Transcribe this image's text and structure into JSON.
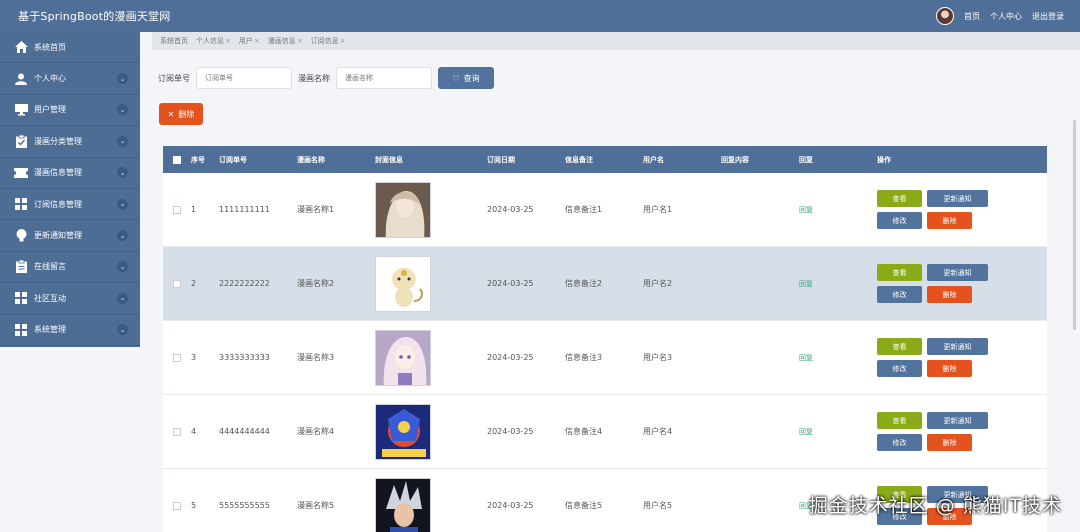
{
  "app": {
    "title": "基于SpringBoot的漫画天堂网"
  },
  "topnav": {
    "home": "首页",
    "profile": "个人中心",
    "logout": "退出登录"
  },
  "sidebar": {
    "items": [
      {
        "label": "系统首页",
        "icon": "home-icon",
        "expandable": false
      },
      {
        "label": "个人中心",
        "icon": "user-icon",
        "expandable": true
      },
      {
        "label": "用户管理",
        "icon": "monitor-icon",
        "expandable": true
      },
      {
        "label": "漫画分类管理",
        "icon": "clipboard-check-icon",
        "expandable": true
      },
      {
        "label": "漫画信息管理",
        "icon": "ticket-icon",
        "expandable": true
      },
      {
        "label": "订阅信息管理",
        "icon": "grid-icon",
        "expandable": true
      },
      {
        "label": "更新通知管理",
        "icon": "bulb-icon",
        "expandable": true
      },
      {
        "label": "在线留言",
        "icon": "clipboard-icon",
        "expandable": true
      },
      {
        "label": "社区互动",
        "icon": "grid-icon",
        "expandable": true
      },
      {
        "label": "系统管理",
        "icon": "grid-icon",
        "expandable": true
      }
    ]
  },
  "breadcrumbs": [
    "系统首页",
    "个人信息",
    "用户",
    "漫画信息",
    "订阅信息"
  ],
  "search": {
    "order_label": "订阅单号",
    "order_placeholder": "订阅单号",
    "comic_label": "漫画名称",
    "comic_placeholder": "漫画名称",
    "query_button": "查询"
  },
  "delete_button": "删除",
  "table": {
    "headers": [
      "序号",
      "订阅单号",
      "漫画名称",
      "封面信息",
      "订阅日期",
      "信息备注",
      "用户名",
      "回复内容",
      "回复",
      "操作"
    ],
    "rows": [
      {
        "index": "1",
        "order_no": "1111111111",
        "comic": "漫画名称1",
        "date": "2024-03-25",
        "note": "信息备注1",
        "user": "用户名1",
        "reply_content": "",
        "reply": "回复"
      },
      {
        "index": "2",
        "order_no": "2222222222",
        "comic": "漫画名称2",
        "date": "2024-03-25",
        "note": "信息备注2",
        "user": "用户名2",
        "reply_content": "",
        "reply": "回复"
      },
      {
        "index": "3",
        "order_no": "3333333333",
        "comic": "漫画名称3",
        "date": "2024-03-25",
        "note": "信息备注3",
        "user": "用户名3",
        "reply_content": "",
        "reply": "回复"
      },
      {
        "index": "4",
        "order_no": "4444444444",
        "comic": "漫画名称4",
        "date": "2024-03-25",
        "note": "信息备注4",
        "user": "用户名4",
        "reply_content": "",
        "reply": "回复"
      },
      {
        "index": "5",
        "order_no": "5555555555",
        "comic": "漫画名称5",
        "date": "2024-03-25",
        "note": "信息备注5",
        "user": "用户名5",
        "reply_content": "",
        "reply": "回复"
      }
    ],
    "actions": {
      "view": "查看",
      "notify": "更新通知",
      "edit": "修改",
      "delete": "删除"
    }
  },
  "watermark": "掘金技术社区 @ 熊猫IT技术",
  "colors": {
    "primary": "#4f6f98",
    "danger": "#e4521e",
    "success": "#8aaa17",
    "row_alt": "#d6dfe8"
  }
}
